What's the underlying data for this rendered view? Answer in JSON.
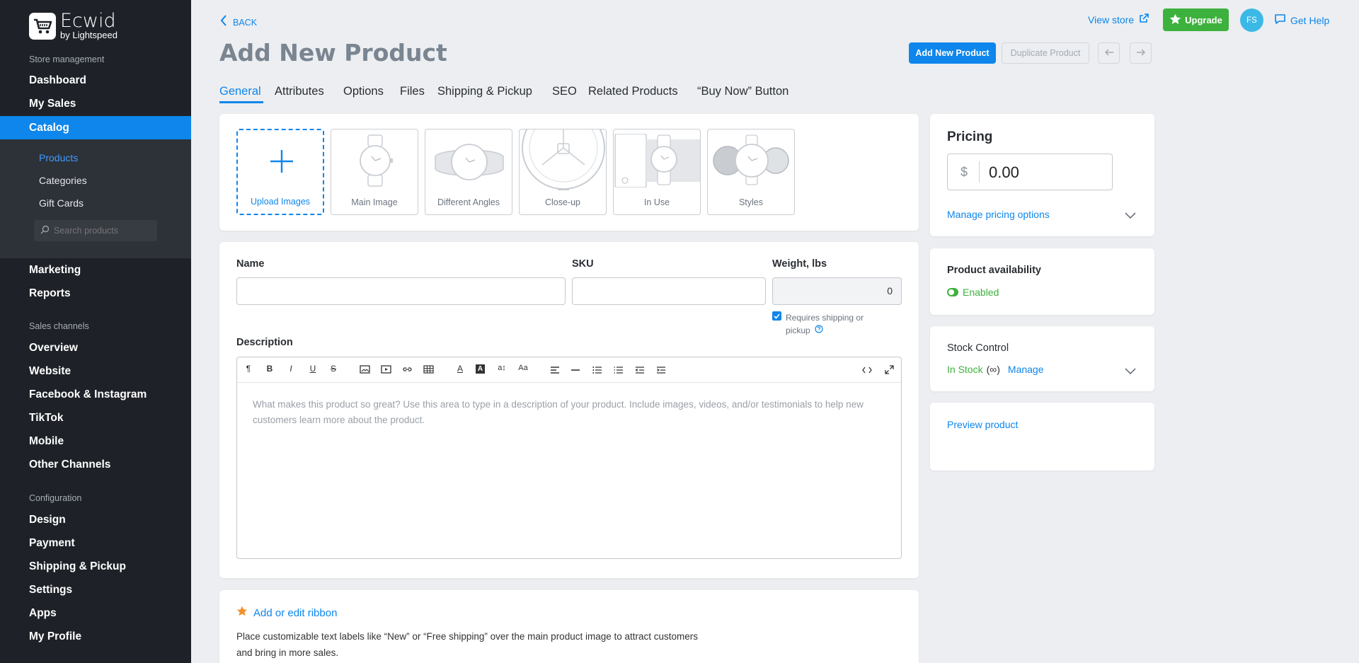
{
  "brand": {
    "name": "Ecwid",
    "sub": "by Lightspeed"
  },
  "sidebar": {
    "section_store": "Store management",
    "dashboard": "Dashboard",
    "my_sales": "My Sales",
    "catalog": "Catalog",
    "catalog_items": [
      "Products",
      "Categories",
      "Gift Cards"
    ],
    "search_placeholder": "Search products",
    "marketing": "Marketing",
    "reports": "Reports",
    "section_channels": "Sales channels",
    "channels": [
      "Overview",
      "Website",
      "Facebook & Instagram",
      "TikTok",
      "Mobile",
      "Other Channels"
    ],
    "section_config": "Configuration",
    "config": [
      "Design",
      "Payment",
      "Shipping & Pickup",
      "Settings",
      "Apps",
      "My Profile"
    ]
  },
  "header": {
    "back": "BACK",
    "title": "Add New Product",
    "view_store": "View store",
    "upgrade": "Upgrade",
    "avatar": "FS",
    "get_help": "Get Help",
    "add_new_product": "Add New Product",
    "duplicate_product": "Duplicate Product"
  },
  "tabs": [
    "General",
    "Attributes",
    "Options",
    "Files",
    "Shipping & Pickup",
    "SEO",
    "Related Products",
    "“Buy Now” Button"
  ],
  "images": {
    "upload": "Upload Images",
    "slots": [
      "Main Image",
      "Different Angles",
      "Close-up",
      "In Use",
      "Styles"
    ]
  },
  "form": {
    "name_label": "Name",
    "sku_label": "SKU",
    "weight_label": "Weight, lbs",
    "weight_value": "0",
    "requires_shipping": "Requires shipping or",
    "requires_shipping_2": "pickup",
    "requires_shipping_checked": true,
    "description_label": "Description",
    "description_placeholder": "What makes this product so great? Use this area to type in a description of your product. Include images, videos, and/or testimonials to help new customers learn more about the product."
  },
  "ribbon": {
    "title": "Add or edit ribbon",
    "text1": "Place customizable text labels like “New” or “Free shipping” over the main product image to attract customers",
    "text2": "and bring in more sales."
  },
  "pricing": {
    "title": "Pricing",
    "currency": "$",
    "price": "0.00",
    "manage": "Manage pricing options"
  },
  "availability": {
    "title": "Product availability",
    "status": "Enabled"
  },
  "stock": {
    "title": "Stock Control",
    "status": "In Stock",
    "infinite": "(∞)",
    "manage": "Manage"
  },
  "preview": "Preview product",
  "colors": {
    "accent": "#0e86eb",
    "green": "#3db13d",
    "sidebar": "#1e2228"
  }
}
